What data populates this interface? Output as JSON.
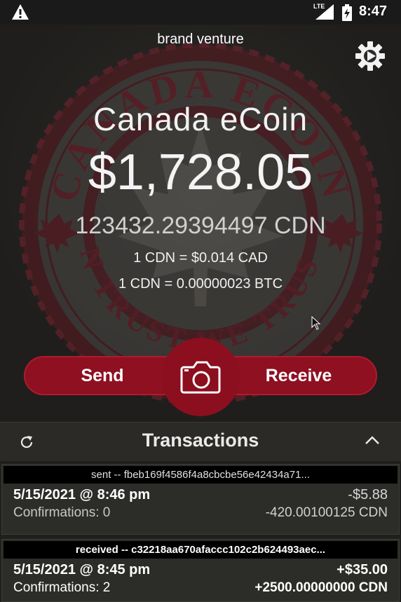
{
  "status_bar": {
    "network": "LTE",
    "time": "8:47"
  },
  "wallet": {
    "name": "brand venture",
    "coin_name": "Canada eCoin",
    "fiat_balance": "$1,728.05",
    "crypto_balance": "123432.29394497  CDN",
    "rate_cad": "1  CDN = $0.014 CAD",
    "rate_btc": "1  CDN = 0.00000023 BTC"
  },
  "seal_text": {
    "top": "CANADA ECOIN",
    "bottom": "IN TRUST WE TRUST"
  },
  "actions": {
    "send_label": "Send",
    "receive_label": "Receive"
  },
  "transactions": {
    "title": "Transactions",
    "items": [
      {
        "header": "sent -- fbeb169f4586f4a8cbcbe56e42434a71...",
        "date": "5/15/2021 @ 8:46 pm",
        "amount": "-$5.88",
        "confirmations": "Confirmations: 0",
        "coin_amount": "-420.00100125 CDN"
      },
      {
        "header": "received -- c32218aa670afaccc102c2b624493aec...",
        "date": "5/15/2021 @ 8:45 pm",
        "amount": "+$35.00",
        "confirmations": "Confirmations: 2",
        "coin_amount": "+2500.00000000 CDN"
      }
    ]
  },
  "colors": {
    "accent": "#8e1021",
    "background": "#1f1f1d"
  }
}
